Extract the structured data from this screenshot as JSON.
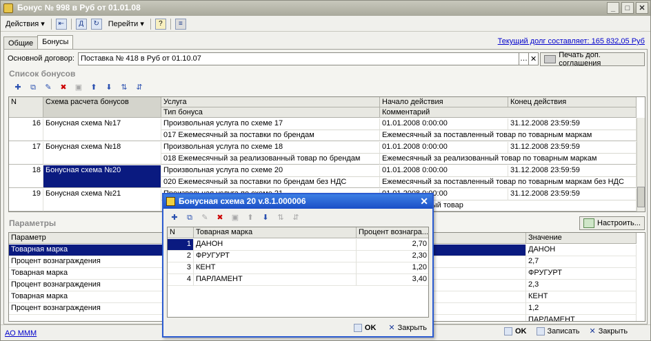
{
  "window": {
    "title": "Бонус № 998 в Руб от 01.01.08"
  },
  "menu": {
    "actions": "Действия",
    "goto": "Перейти"
  },
  "tabs": [
    "Общие",
    "Бонусы"
  ],
  "debt_link": "Текущий долг составляет: 165 832,05 Руб",
  "contract": {
    "label": "Основной договор:",
    "value": "Поставка № 418 в Руб от 01.10.07",
    "print_btn": "Печать доп. соглашения"
  },
  "bonus_list": {
    "heading": "Список бонусов",
    "headers": {
      "n": "N",
      "scheme": "Схема расчета бонусов",
      "service": "Услуга",
      "bonus_type": "Тип бонуса",
      "start": "Начало действия",
      "comment": "Комментарий",
      "end": "Конец действия"
    },
    "rows": [
      {
        "n": "16",
        "scheme": "Бонусная схема №17",
        "service": "Произвольная услуга по схеме 17",
        "type": "017 Ежемесячный за поставки по брендам",
        "start": "01.01.2008 0:00:00",
        "end": "31.12.2008 23:59:59",
        "comment": "Ежемесячный за поставленный товар по товарным маркам"
      },
      {
        "n": "17",
        "scheme": "Бонусная схема №18",
        "service": "Произвольная услуга по схеме 18",
        "type": "018 Ежемесячный за реализованный товар по брендам",
        "start": "01.01.2008 0:00:00",
        "end": "31.12.2008 23:59:59",
        "comment": "Ежемесячный за реализованный товар по товарным маркам"
      },
      {
        "n": "18",
        "scheme": "Бонусная схема №20",
        "service": "Произвольная услуга по схеме 20",
        "type": "020 Ежемесячный за поставки по брендам без НДС",
        "start": "01.01.2008 0:00:00",
        "end": "31.12.2008 23:59:59",
        "comment": "Ежемесячный за поставленный товар по товарным маркам без НДС"
      },
      {
        "n": "19",
        "scheme": "Бонусная схема №21",
        "service": "Произвольная услуга по схеме 21",
        "type": "",
        "start": "01.01.2008 0:00:00",
        "end": "31.12.2008 23:59:59",
        "comment": "...за оплаченный товар"
      }
    ]
  },
  "params": {
    "heading": "Параметры",
    "setup_btn": "Настроить...",
    "headers": {
      "param": "Параметр",
      "value": "Значение"
    },
    "rows": [
      {
        "param": "Товарная марка",
        "value": "ДАНОН"
      },
      {
        "param": "Процент вознаграждения",
        "value": "2,7"
      },
      {
        "param": "Товарная марка",
        "value": "ФРУГУРТ"
      },
      {
        "param": "Процент вознаграждения",
        "value": "2,3"
      },
      {
        "param": "Товарная марка",
        "value": "КЕНТ"
      },
      {
        "param": "Процент вознаграждения",
        "value": "1,2"
      },
      {
        "param": "",
        "value": "ПАРЛАМЕНТ"
      }
    ]
  },
  "footer": {
    "org": "АО МММ",
    "ok": "OK",
    "save": "Записать",
    "close": "Закрыть"
  },
  "dialog": {
    "title": "Бонусная схема 20 v.8.1.000006",
    "headers": {
      "n": "N",
      "brand": "Товарная марка",
      "percent": "Процент вознагра..."
    },
    "rows": [
      {
        "n": "1",
        "brand": "ДАНОН",
        "percent": "2,70"
      },
      {
        "n": "2",
        "brand": "ФРУГУРТ",
        "percent": "2,30"
      },
      {
        "n": "3",
        "brand": "КЕНТ",
        "percent": "1,20"
      },
      {
        "n": "4",
        "brand": "ПАРЛАМЕНТ",
        "percent": "3,40"
      }
    ],
    "ok": "OK",
    "close": "Закрыть"
  }
}
